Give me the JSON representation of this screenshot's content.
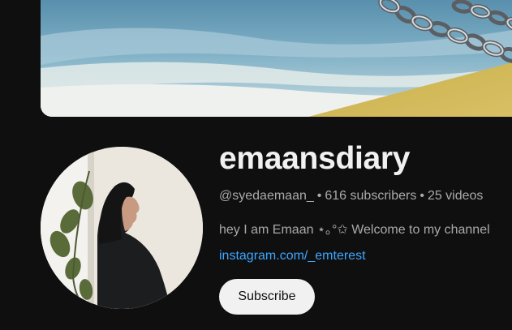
{
  "channel": {
    "name": "emaansdiary",
    "handle": "@syedaemaan_",
    "subscribers": "616 subscribers",
    "videos": "25 videos",
    "separator": "•",
    "description": "hey I am Emaan ⋆｡°✩ Welcome to my channel",
    "link": "instagram.com/_emterest"
  },
  "actions": {
    "subscribe_label": "Subscribe"
  },
  "colors": {
    "background": "#0f0f0f",
    "primary_text": "#f1f1f1",
    "secondary_text": "#aaaaaa",
    "link": "#3ea6ff",
    "subscribe_bg": "#f1f1f1"
  }
}
